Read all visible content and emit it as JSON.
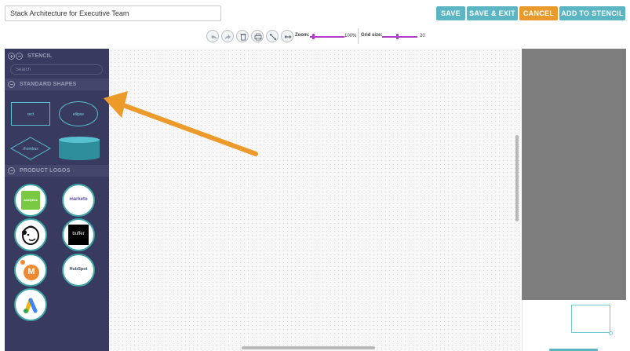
{
  "header": {
    "diagram_title_value": "Stack Architecture for Executive Team",
    "buttons": {
      "save": "SAVE",
      "save_exit": "SAVE & EXIT",
      "cancel": "CANCEL",
      "add_to_stencil": "ADD TO STENCIL"
    }
  },
  "toolbar": {
    "tools": [
      "undo-icon",
      "redo-icon",
      "delete-icon",
      "print-icon",
      "fit-icon",
      "resize-icon"
    ],
    "zoom_label": "Zoom:",
    "zoom_value": "100%",
    "grid_label": "Grid size:",
    "grid_value": "20"
  },
  "sidebar": {
    "stencil_title": "STENCIL",
    "search_placeholder": "Search",
    "standard_shapes_title": "STANDARD SHAPES",
    "shapes": {
      "rect": "rect",
      "ellipse": "ellipse",
      "rhombus": "rhombus"
    },
    "product_logos_title": "PRODUCT LOGOS",
    "logos": {
      "analytics": "Analytics",
      "marketo": "marketo",
      "buffer": "buffer",
      "hubspot": "HubSpot",
      "m": "M"
    }
  },
  "colors": {
    "accent": "#5bb5c2",
    "cancel": "#e89a2c",
    "sidebar_bg": "#393a5f",
    "annotation_arrow": "#ec9a2a"
  }
}
